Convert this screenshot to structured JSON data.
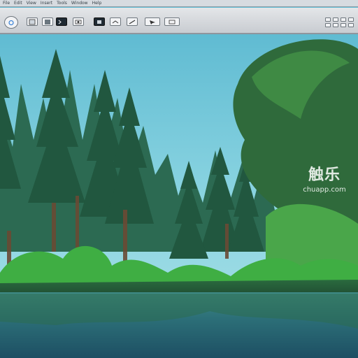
{
  "menubar": {
    "items": [
      "File",
      "Edit",
      "View",
      "Insert",
      "Tools",
      "Window",
      "Help"
    ]
  },
  "toolbar": {
    "buttons": [
      {
        "name": "scene-icon"
      },
      {
        "name": "file-icon"
      },
      {
        "name": "save-icon"
      },
      {
        "name": "terminal-icon"
      },
      {
        "name": "camera-icon"
      },
      {
        "name": "render-icon"
      },
      {
        "name": "layers-icon"
      },
      {
        "name": "brush-icon"
      },
      {
        "name": "settings-icon"
      }
    ]
  },
  "watermark": {
    "logo": "触乐",
    "domain": "chuapp.com"
  },
  "colors": {
    "sky": "#6cc3d6",
    "forest": "#1e4f3f",
    "grass": "#3fae43",
    "water": "#2e6a72"
  }
}
